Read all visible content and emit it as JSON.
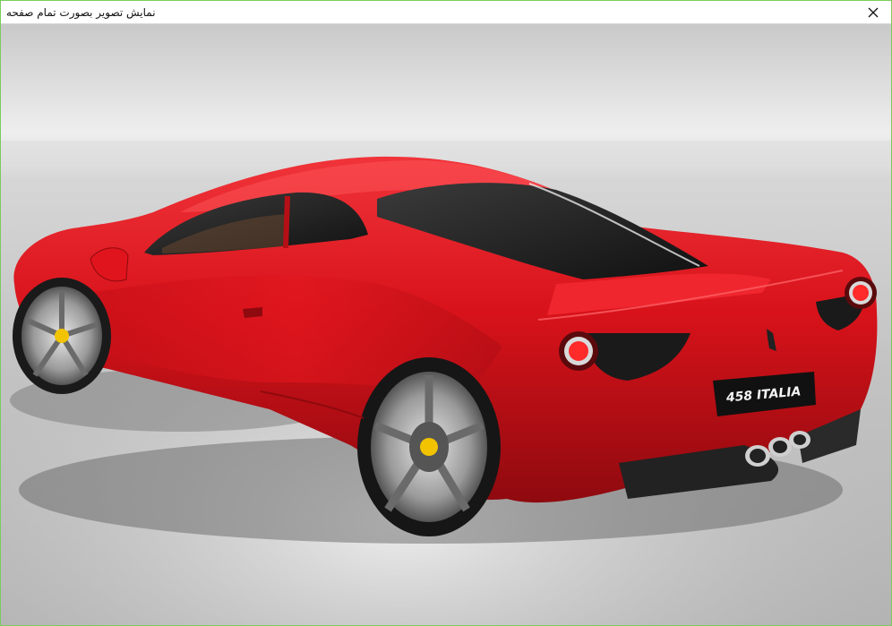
{
  "window": {
    "title": "نمایش تصویر بصورت تمام صفحه",
    "close_icon": "close-icon"
  },
  "image": {
    "subject": "red sports car photo",
    "plate_text": "458 ITALIA",
    "colors": {
      "body": "#e0141c",
      "body_dark": "#8e0a0f",
      "background_light": "#f2f2f2",
      "background_dark": "#9a9a9a",
      "window_border": "#7ccb5c"
    }
  }
}
